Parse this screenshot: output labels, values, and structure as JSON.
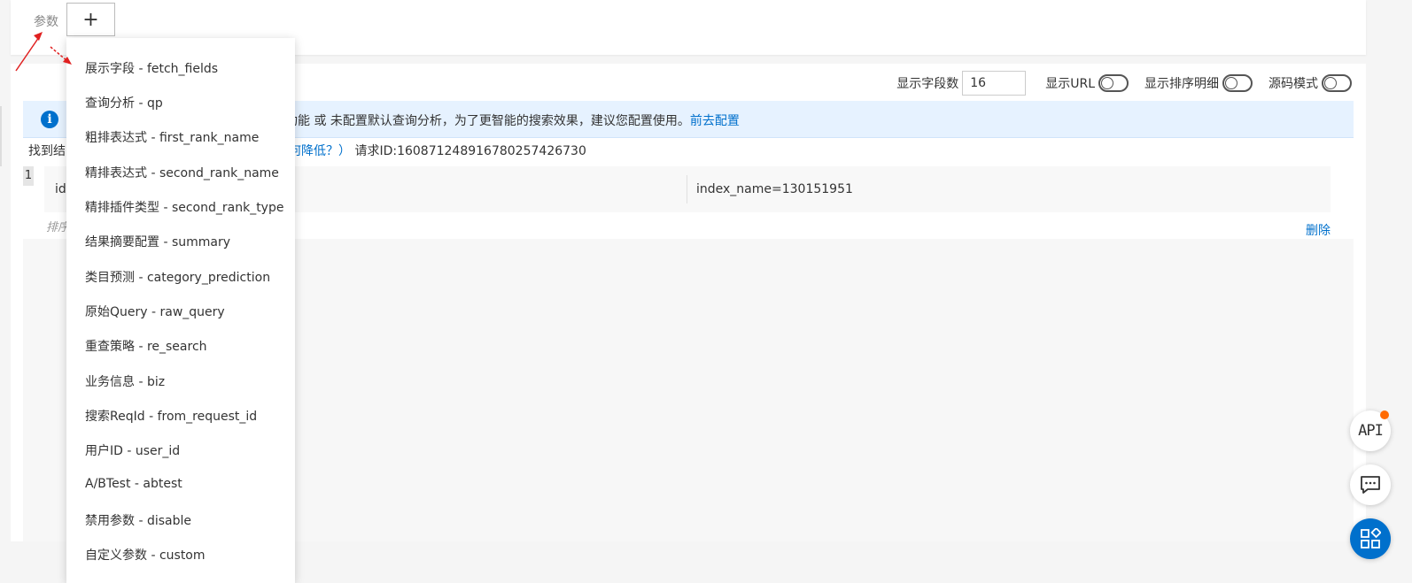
{
  "params": {
    "label": "参数",
    "add_symbol": "+"
  },
  "toolbar": {
    "field_count_label": "显示字段数",
    "field_count_value": "16",
    "show_url_label": "显示URL",
    "show_sort_detail_label": "显示排序明细",
    "source_mode_label": "源码模式"
  },
  "info": {
    "message": "功能 或 未配置默认查询分析，为了更智能的搜索效果，建议您配置使用。",
    "link": "前去配置"
  },
  "results": {
    "found_prefix": "找到结",
    "found_link": "如何降低？）",
    "request_id": "请求ID:160871248916780257426730",
    "row_index": "1",
    "id_label": "id",
    "index_name": "index_name=130151951",
    "sort_detail": "排序",
    "delete_label": "删除"
  },
  "dropdown": {
    "items": [
      "展示字段 - fetch_fields",
      "查询分析 - qp",
      "粗排表达式 - first_rank_name",
      "精排表达式 - second_rank_name",
      "精排插件类型 - second_rank_type",
      "结果摘要配置 - summary",
      "类目预测 - category_prediction",
      "原始Query - raw_query",
      "重查策略 - re_search",
      "业务信息 - biz",
      "搜索ReqId - from_request_id",
      "用户ID - user_id",
      "A/BTest - abtest",
      "禁用参数 - disable",
      "自定义参数 - custom"
    ]
  },
  "float_buttons": {
    "api_label": "API"
  },
  "colors": {
    "accent": "#0070cc",
    "badge": "#ff6a00",
    "annotation_arrow": "#e02020"
  }
}
